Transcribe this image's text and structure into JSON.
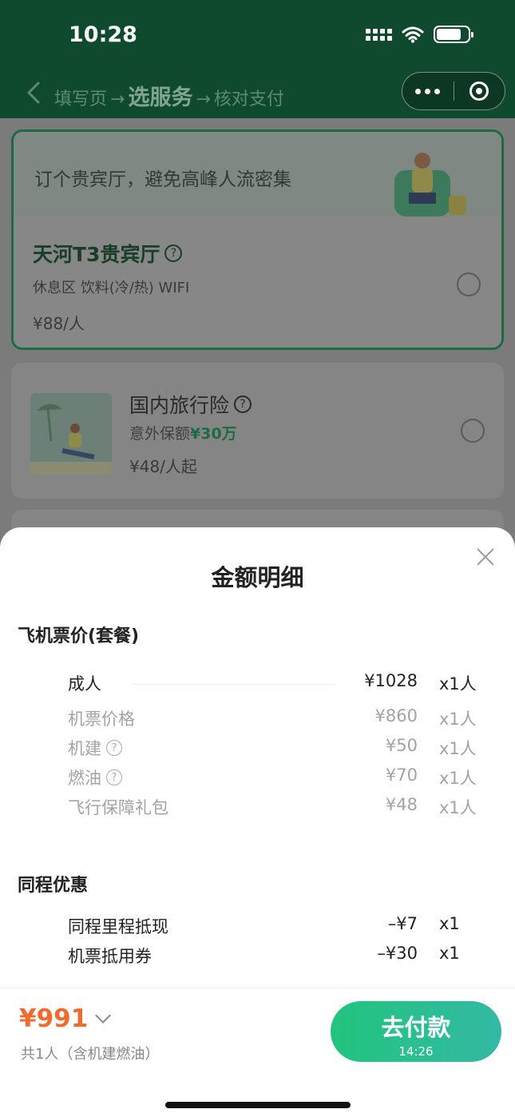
{
  "status_bar": {
    "time": "10:28"
  },
  "nav": {
    "steps": [
      "填写页",
      "选服务",
      "核对支付"
    ],
    "arrow": "→",
    "current_step": "选服务"
  },
  "lounge_card": {
    "banner": "订个贵宾厅，避免高峰人流密集",
    "title": "天河T3贵宾厅",
    "features": "休息区 饮料(冷/热) WIFI",
    "price": "¥88/人"
  },
  "insurance_card": {
    "title": "国内旅行险",
    "subtitle_prefix": "意外保额",
    "subtitle_highlight": "¥30万",
    "price": "¥48/人起"
  },
  "sheet": {
    "title": "金额明细",
    "sections": [
      {
        "title": "飞机票价(套餐)",
        "rows": [
          {
            "label": "成人",
            "amount": "¥1028",
            "qty": "x1人",
            "kind": "main"
          },
          {
            "label": "机票价格",
            "amount": "¥860",
            "qty": "x1人",
            "kind": "sub"
          },
          {
            "label": "机建",
            "amount": "¥50",
            "qty": "x1人",
            "kind": "sub",
            "help": true
          },
          {
            "label": "燃油",
            "amount": "¥70",
            "qty": "x1人",
            "kind": "sub",
            "help": true
          },
          {
            "label": "飞行保障礼包",
            "amount": "¥48",
            "qty": "x1人",
            "kind": "sub"
          }
        ]
      },
      {
        "title": "同程优惠",
        "rows": [
          {
            "label": "同程里程抵现",
            "amount": "–¥7",
            "qty": "x1",
            "kind": "disc"
          },
          {
            "label": "机票抵用券",
            "amount": "–¥30",
            "qty": "x1",
            "kind": "disc"
          }
        ]
      }
    ]
  },
  "footer": {
    "total": "¥991",
    "note": "共1人（含机建燃油）",
    "pay_label": "去付款",
    "timer": "14:26"
  },
  "colors": {
    "brand_green": "#1d6a44",
    "total_orange": "#ef6b2e",
    "pay_gradient_start": "#21c47d",
    "pay_gradient_end": "#33b9a4"
  }
}
